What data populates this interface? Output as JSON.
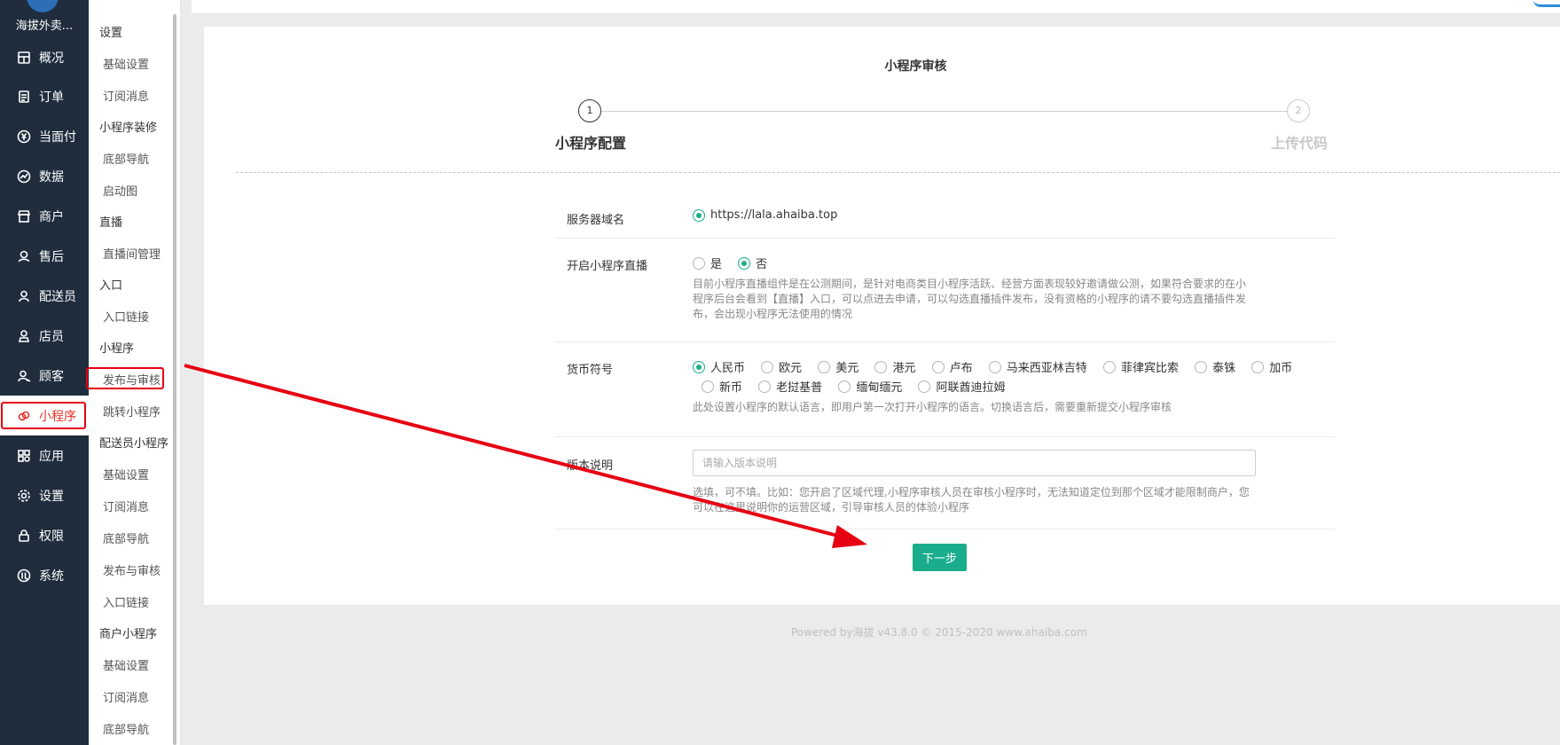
{
  "sidebar": {
    "brand": "海拔外卖...",
    "items": [
      {
        "label": "概况",
        "icon": "dashboard-icon"
      },
      {
        "label": "订单",
        "icon": "order-icon"
      },
      {
        "label": "当面付",
        "icon": "yuan-icon"
      },
      {
        "label": "数据",
        "icon": "chart-icon"
      },
      {
        "label": "商户",
        "icon": "store-icon"
      },
      {
        "label": "售后",
        "icon": "service-icon"
      },
      {
        "label": "配送员",
        "icon": "user-icon"
      },
      {
        "label": "店员",
        "icon": "staff-icon"
      },
      {
        "label": "顾客",
        "icon": "customer-icon"
      },
      {
        "label": "小程序",
        "icon": "miniprogram-icon",
        "active": true
      },
      {
        "label": "应用",
        "icon": "apps-icon"
      },
      {
        "label": "设置",
        "icon": "gear-icon"
      },
      {
        "label": "权限",
        "icon": "lock-icon"
      },
      {
        "label": "系统",
        "icon": "system-icon"
      }
    ]
  },
  "subnav": {
    "entries": [
      {
        "type": "group",
        "label": "设置"
      },
      {
        "type": "item",
        "label": "基础设置"
      },
      {
        "type": "item",
        "label": "订阅消息"
      },
      {
        "type": "group",
        "label": "小程序装修"
      },
      {
        "type": "item",
        "label": "底部导航"
      },
      {
        "type": "item",
        "label": "启动图"
      },
      {
        "type": "group",
        "label": "直播"
      },
      {
        "type": "item",
        "label": "直播间管理"
      },
      {
        "type": "group",
        "label": "入口"
      },
      {
        "type": "item",
        "label": "入口链接"
      },
      {
        "type": "group",
        "label": "小程序"
      },
      {
        "type": "item",
        "label": "发布与审核",
        "highlighted": true
      },
      {
        "type": "item",
        "label": "跳转小程序"
      },
      {
        "type": "group",
        "label": "配送员小程序"
      },
      {
        "type": "item",
        "label": "基础设置"
      },
      {
        "type": "item",
        "label": "订阅消息"
      },
      {
        "type": "item",
        "label": "底部导航"
      },
      {
        "type": "item",
        "label": "发布与审核"
      },
      {
        "type": "item",
        "label": "入口链接"
      },
      {
        "type": "group",
        "label": "商户小程序"
      },
      {
        "type": "item",
        "label": "基础设置"
      },
      {
        "type": "item",
        "label": "订阅消息"
      },
      {
        "type": "item",
        "label": "底部导航"
      }
    ]
  },
  "page": {
    "title": "小程序审核",
    "steps": [
      {
        "number": "1",
        "label": "小程序配置",
        "active": true
      },
      {
        "number": "2",
        "label": "上传代码",
        "active": false
      }
    ]
  },
  "form": {
    "server_domain": {
      "label": "服务器域名",
      "value": "https://lala.ahaiba.top"
    },
    "live": {
      "label": "开启小程序直播",
      "options": [
        "是",
        "否"
      ],
      "selected": "否",
      "help": "目前小程序直播组件是在公测期间，是针对电商类目小程序活跃、经营方面表现较好邀请做公测，如果符合要求的在小程序后台会看到【直播】入口，可以点进去申请，可以勾选直播插件发布，没有资格的小程序的请不要勾选直播插件发布，会出现小程序无法使用的情况"
    },
    "currency": {
      "label": "货币符号",
      "options_row1": [
        "人民币",
        "欧元",
        "美元",
        "港元",
        "卢布",
        "马来西亚林吉特",
        "菲律宾比索",
        "泰铢",
        "加币"
      ],
      "options_row2": [
        "新币",
        "老挝基普",
        "缅甸缅元",
        "阿联酋迪拉姆"
      ],
      "selected": "人民币",
      "help": "此处设置小程序的默认语言，即用户第一次打开小程序的语言。切换语言后，需要重新提交小程序审核"
    },
    "version": {
      "label": "版本说明",
      "value": "",
      "placeholder": "请输入版本说明",
      "help": "选填，可不填。比如：您开启了区域代理,小程序审核人员在审核小程序时，无法知道定位到那个区域才能限制商户，您可以在这里说明你的运营区域，引导审核人员的体验小程序"
    },
    "next_label": "下一步"
  },
  "footer": "Powered by海拔 v43.8.0 © 2015-2020 www.ahaiba.com",
  "colors": {
    "sidebar_bg": "#1f2d3d",
    "accent": "#1aad8c",
    "highlight": "#e60012"
  }
}
